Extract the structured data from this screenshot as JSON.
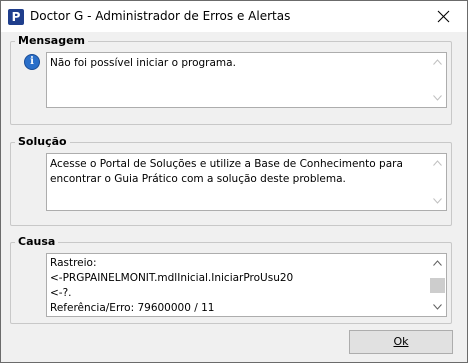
{
  "window": {
    "title": "Doctor G - Administrador de Erros e Alertas",
    "icon_letter": "P"
  },
  "message": {
    "legend": "Mensagem",
    "text": "Não foi possível iniciar o programa."
  },
  "solution": {
    "legend": "Solução",
    "text": "Acesse o Portal de Soluções e utilize a Base de Conhecimento para encontrar o Guia Prático com a solução deste problema."
  },
  "cause": {
    "legend": "Causa",
    "lines": [
      "Rastreio:",
      "<-PRGPAINELMONIT.mdlInicial.IniciarProUsu20",
      "<-?.",
      "Referência/Erro: 79600000 / 11"
    ]
  },
  "buttons": {
    "ok": "Ok"
  },
  "icons": {
    "app": "app-icon",
    "info": "info-icon",
    "close": "close-icon"
  }
}
